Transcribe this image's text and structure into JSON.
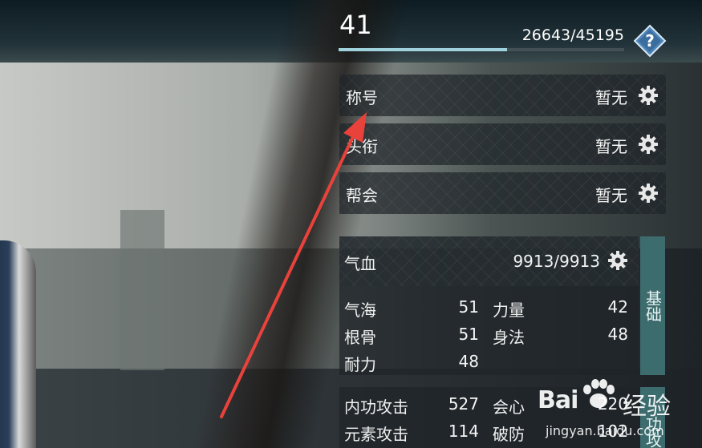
{
  "header": {
    "level": "41",
    "exp_text": "26643/45195",
    "exp_progress": 0.589,
    "help_icon": "question-diamond-icon"
  },
  "identity_rows": [
    {
      "label": "称号",
      "value": "暂无",
      "icon": "gear-icon"
    },
    {
      "label": "头衔",
      "value": "暂无",
      "icon": "gear-icon"
    },
    {
      "label": "帮会",
      "value": "暂无",
      "icon": "gear-icon"
    }
  ],
  "basic": {
    "tab_label": "基础",
    "hp_label": "气血",
    "hp_value": "9913/9913",
    "stats_left": [
      {
        "label": "气海",
        "value": "51"
      },
      {
        "label": "根骨",
        "value": "51"
      },
      {
        "label": "耐力",
        "value": "48"
      }
    ],
    "stats_right": [
      {
        "label": "力量",
        "value": "42"
      },
      {
        "label": "身法",
        "value": "48"
      }
    ]
  },
  "attack": {
    "tab_label": "功攻",
    "stats_left": [
      {
        "label": "内功攻击",
        "value": "527"
      },
      {
        "label": "元素攻击",
        "value": "114"
      }
    ],
    "stats_right": [
      {
        "label": "会心",
        "value": "220"
      },
      {
        "label": "破防",
        "value": "102"
      }
    ]
  },
  "watermark": {
    "brand": "Bai",
    "brand_tail": "经验",
    "url": "jingyan.baidu.com"
  },
  "colors": {
    "accent_teal": "#3d6c6f",
    "exp_bar": "#9fd2dc",
    "annotation_arrow": "#e8423b"
  }
}
